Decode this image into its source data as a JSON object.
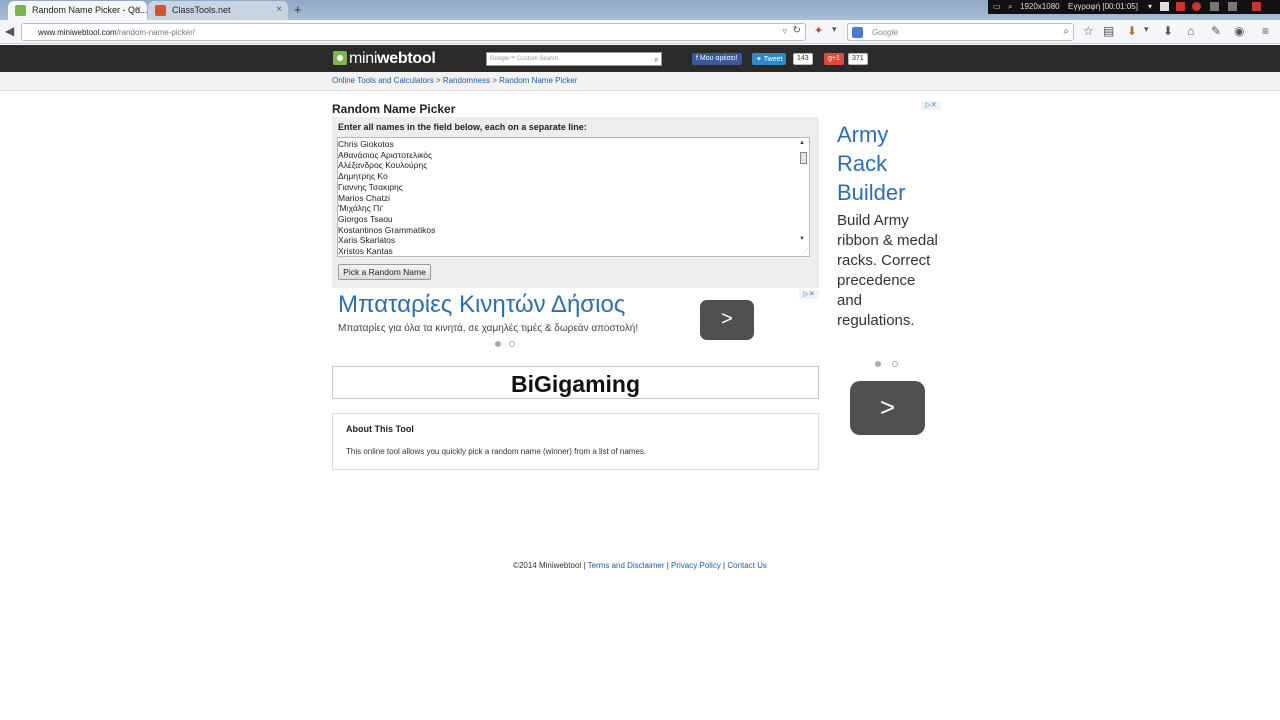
{
  "browser": {
    "tabs": [
      {
        "title": "Random Name Picker - Qu...",
        "active": true
      },
      {
        "title": "ClassTools.net",
        "active": false
      }
    ],
    "new_tab_symbol": "+",
    "close_symbol": "×",
    "url_host": "www.miniwebtool.com",
    "url_path": "/random-name-picker/",
    "search_engine_placeholder": "Google",
    "nav_icons": [
      "back-icon",
      "reload-icon",
      "star-icon",
      "bookmarks-icon",
      "download-icon",
      "home-icon",
      "menu-icon"
    ]
  },
  "recorder": {
    "resolution": "1920x1080",
    "status": "Εγγραφή [00:01:05]"
  },
  "site": {
    "logo_light": "mini",
    "logo_bold": "webtool",
    "search_placeholder": "Custom Search",
    "search_brand": "Google™",
    "facebook_label": "Μου αρέσει!",
    "tweet_label": "Tweet",
    "tweet_count": "143",
    "gplus_label": "+1",
    "gplus_count": "371"
  },
  "breadcrumbs": [
    "Online Tools and Calculators",
    "Randomness",
    "Random Name Picker"
  ],
  "tool": {
    "title": "Random Name Picker",
    "instruction": "Enter all names in the field below, each on a separate line:",
    "names": [
      "Chris Giokotos",
      "Αθανάσιος Αριστοτελικός",
      "Αλέξανδρος Κουλούρης",
      "Δημητρης Κο",
      "Γιαννης Τσακιρης",
      "Marios Chatzi",
      "'Μιχάλης Πι'",
      "Giorgos Tsaou",
      "Kostantinos Grammatikos",
      "Xaris Skarlatos",
      "Xristos Kantas"
    ],
    "pick_button": "Pick a Random Name",
    "result": "BiGigaming"
  },
  "ad_inline": {
    "headline": "Μπαταρίες Κινητών Δήσιος",
    "description": "Μπαταρίες για όλα τα κινητά, σε χαμηλές τιμές & δωρεάν αποστολή!",
    "arrow": ">"
  },
  "ad_side": {
    "headline": "Army Rack Builder",
    "description": "Build Army ribbon & medal racks. Correct precedence and regulations.",
    "arrow": ">"
  },
  "about": {
    "title": "About This Tool",
    "text": "This online tool allows you quickly pick a random name (winner) from a list of names."
  },
  "footer": {
    "copyright": "©2014 Miniwebtool",
    "links": [
      "Terms and Disclaimer",
      "Privacy Policy",
      "Contact Us"
    ]
  },
  "colors": {
    "link": "#1a5ea8",
    "ad_headline": "#2a6fb6",
    "header_bg": "#2a2a2a",
    "logo_green": "#79b74a"
  }
}
